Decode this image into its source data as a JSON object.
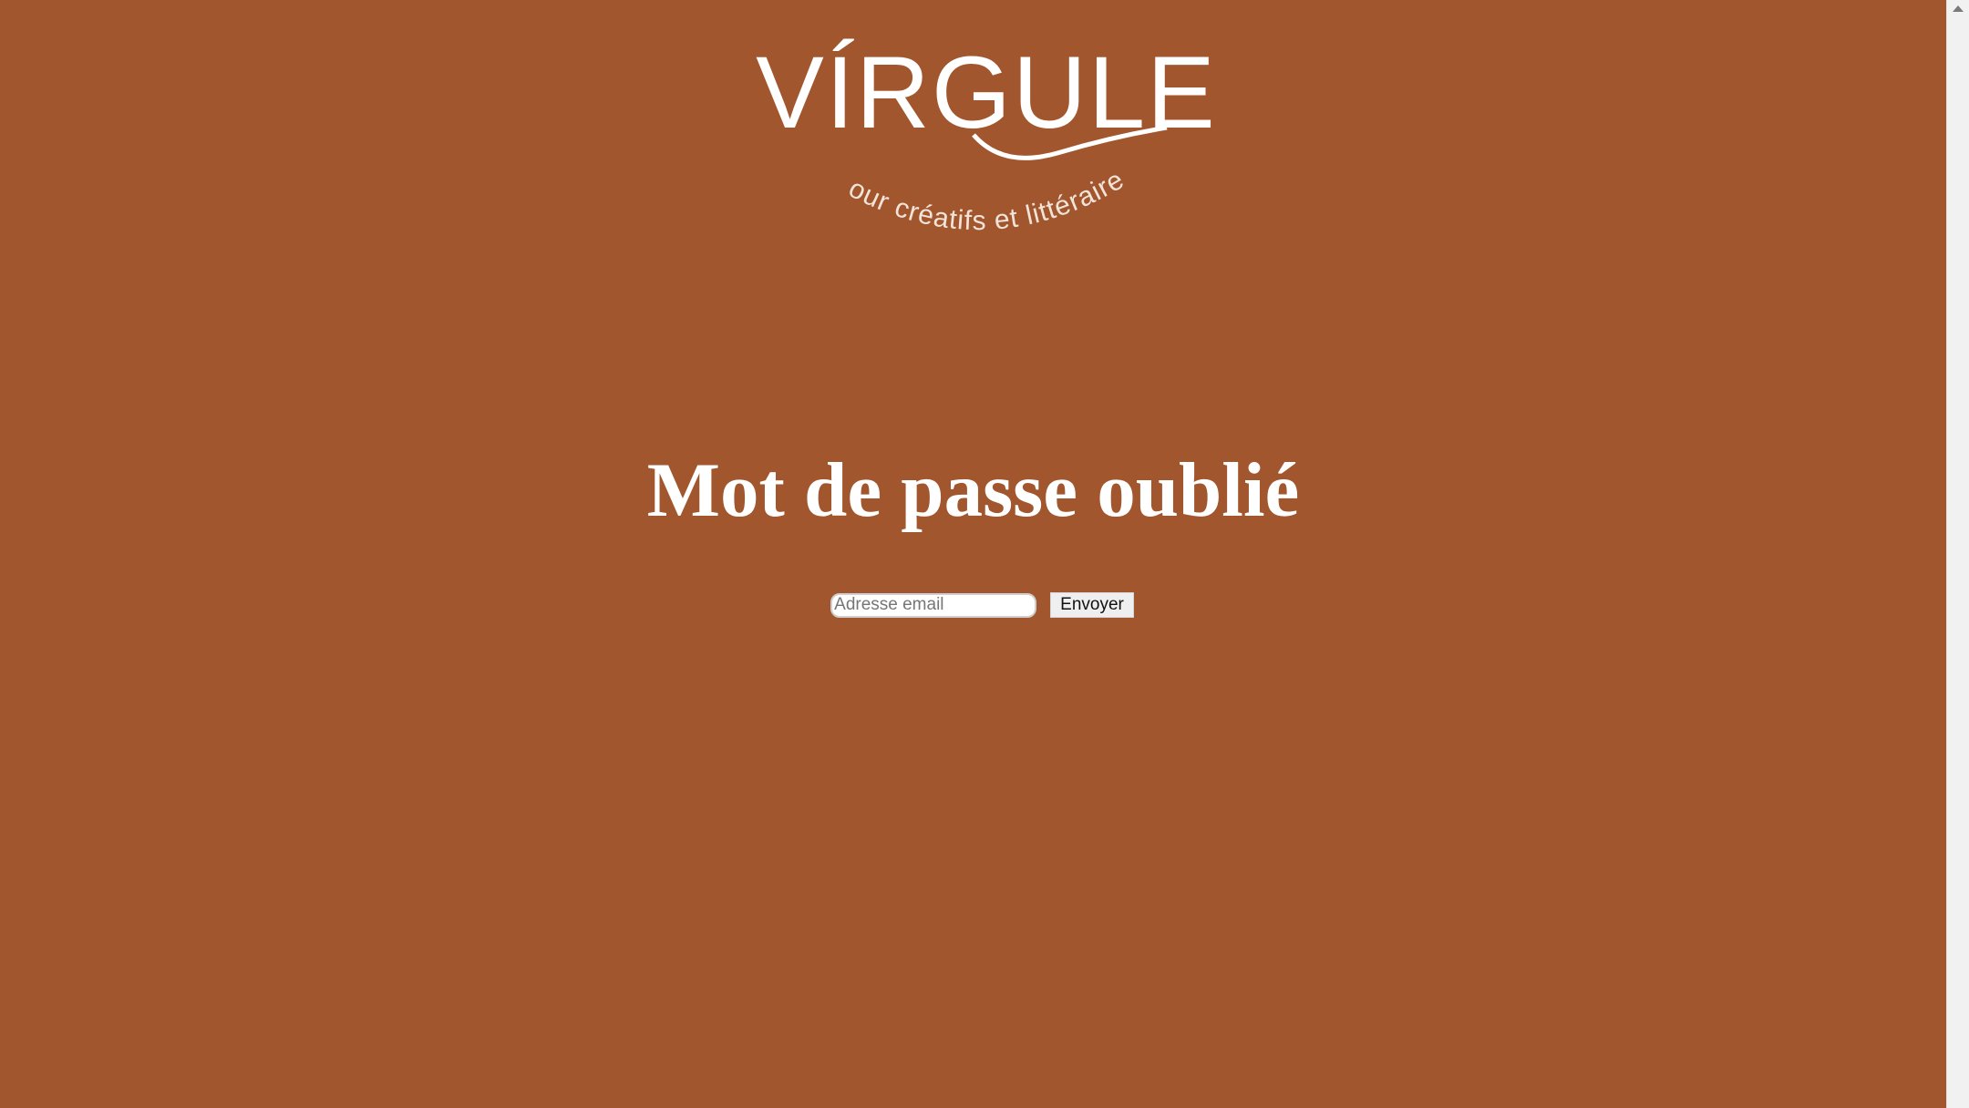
{
  "logo": {
    "wordmark": "VÍRGULE",
    "tagline": "Pour créatifs et littéraires"
  },
  "page": {
    "title": "Mot de passe oublié"
  },
  "form": {
    "email_placeholder": "Adresse email",
    "email_value": "",
    "submit_label": "Envoyer"
  },
  "colors": {
    "background": "#a2562e",
    "text": "#ffffff"
  },
  "icons": {
    "scroll_up": "triangle-up"
  }
}
